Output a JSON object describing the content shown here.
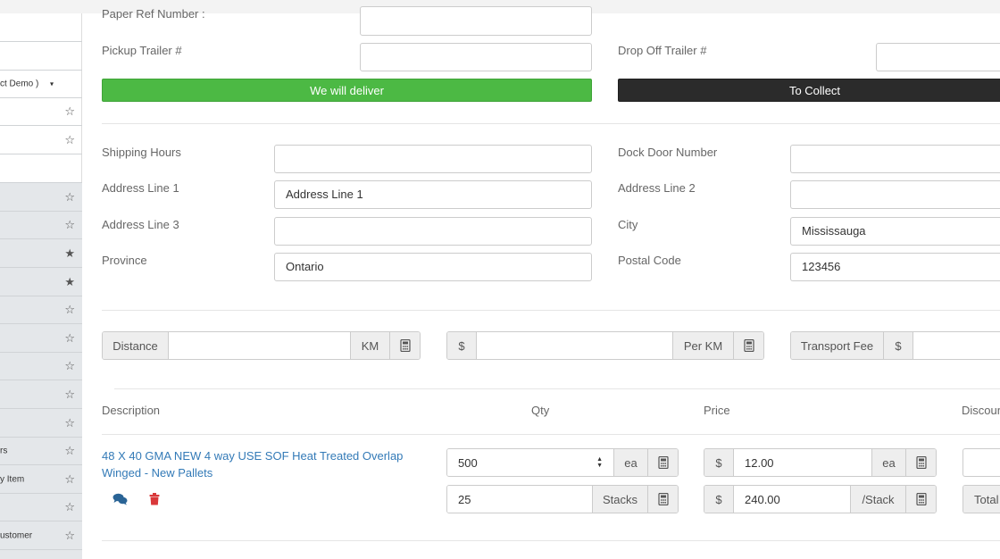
{
  "sidebar": {
    "items": [
      {
        "label": "",
        "gray": false,
        "star": ""
      },
      {
        "label": "ct Demo )",
        "gray": false,
        "star": "",
        "caret": "▾"
      },
      {
        "label": "",
        "gray": false,
        "star": "☆"
      },
      {
        "label": "",
        "gray": false,
        "star": "☆"
      },
      {
        "label": "",
        "gray": false,
        "star": ""
      },
      {
        "label": "",
        "gray": true,
        "star": "☆"
      },
      {
        "label": "",
        "gray": true,
        "star": "☆"
      },
      {
        "label": "",
        "gray": true,
        "star": "★"
      },
      {
        "label": "",
        "gray": true,
        "star": "★"
      },
      {
        "label": "",
        "gray": true,
        "star": "☆"
      },
      {
        "label": "",
        "gray": true,
        "star": "☆"
      },
      {
        "label": "",
        "gray": true,
        "star": "☆"
      },
      {
        "label": "",
        "gray": true,
        "star": "☆"
      },
      {
        "label": "",
        "gray": true,
        "star": "☆"
      },
      {
        "label": "rs",
        "gray": true,
        "star": "☆"
      },
      {
        "label": "y Item",
        "gray": true,
        "star": "☆"
      },
      {
        "label": "",
        "gray": true,
        "star": "☆"
      },
      {
        "label": "ustomer",
        "gray": true,
        "star": "☆"
      },
      {
        "label": "",
        "gray": true,
        "star": ""
      }
    ]
  },
  "form": {
    "paper_ref_label": "Paper Ref Number :",
    "pickup_trailer_label": "Pickup Trailer #",
    "drop_off_trailer_label": "Drop Off Trailer #",
    "deliver_button": "We will deliver",
    "collect_button": "To Collect",
    "shipping_hours_label": "Shipping Hours",
    "dock_door_label": "Dock Door Number",
    "address1_label": "Address Line 1",
    "address1_value": "Address Line 1",
    "address2_label": "Address Line 2",
    "address2_value": "",
    "address3_label": "Address Line 3",
    "address3_value": "",
    "city_label": "City",
    "city_value": "Mississauga",
    "province_label": "Province",
    "province_value": "Ontario",
    "postal_label": "Postal Code",
    "postal_value": "123456"
  },
  "transport": {
    "distance_label": "Distance",
    "distance_value": "",
    "km_unit": "KM",
    "dollar": "$",
    "per_km_value": "",
    "per_km_label": "Per KM",
    "transport_fee_label": "Transport Fee",
    "transport_fee_value": ""
  },
  "table": {
    "headers": {
      "description": "Description",
      "qty": "Qty",
      "price": "Price",
      "discount": "Discoun"
    },
    "row": {
      "description": "48 X 40 GMA NEW 4 way USE SOF Heat Treated Overlap Winged - New Pallets",
      "qty": "500",
      "qty_unit": "ea",
      "stacks": "25",
      "stacks_unit": "Stacks",
      "price_currency": "$",
      "price": "12.00",
      "price_unit": "ea",
      "stack_price": "240.00",
      "stack_unit": "/Stack",
      "total_label": "Total"
    }
  },
  "colors": {
    "green": "#4cb944",
    "dark": "#2b2b2b",
    "link": "#337ab7",
    "delete": "#d9383a"
  }
}
